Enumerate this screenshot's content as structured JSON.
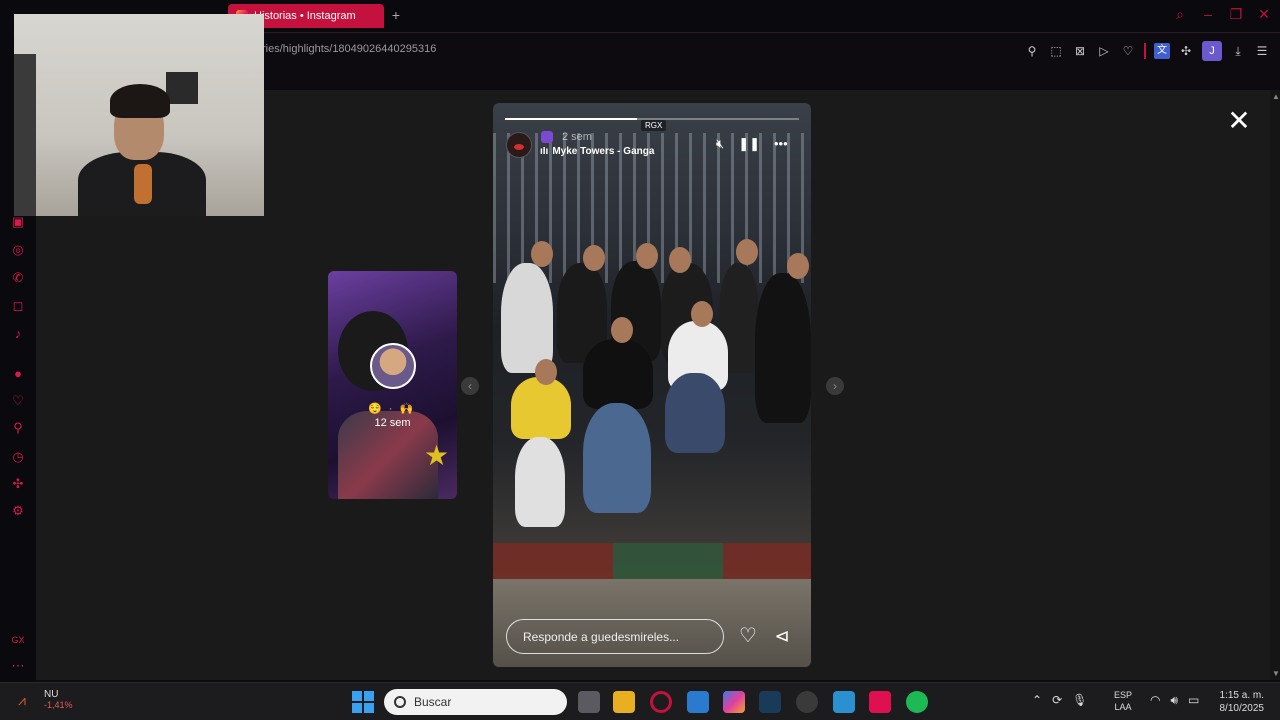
{
  "browser": {
    "active_tab_title": "Historias • Instagram",
    "url": "ries/highlights/18049026440295316",
    "new_tab_label": "+"
  },
  "story_viewer": {
    "prev_story": {
      "time_ago": "12 sem",
      "emojis": "😌 · 🙌"
    },
    "current_story": {
      "tag": "RGX",
      "time_ago": "2 sem",
      "music": "Myke Towers - Ganga",
      "progress_fraction": 0.45,
      "reply_placeholder": "Responde a guedesmireles..."
    }
  },
  "taskbar": {
    "stock_name": "NU",
    "stock_change": "-1,41%",
    "search_placeholder": "Buscar",
    "lang_top": "ESP",
    "lang_bottom": "LAA",
    "time": "1:15 a. m.",
    "date": "8/10/2025"
  },
  "colors": {
    "accent": "#c4113d",
    "sidebar_icons": "#d8194a"
  }
}
